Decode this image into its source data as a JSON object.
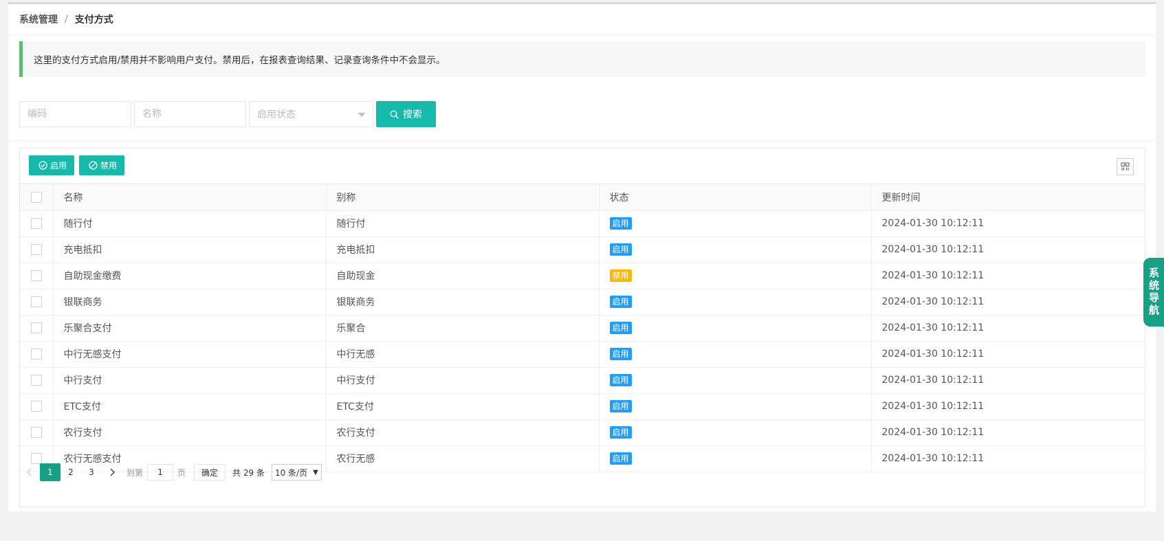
{
  "breadcrumb": {
    "parent": "系统管理",
    "separator": "/",
    "current": "支付方式"
  },
  "notice": "这里的支付方式启用/禁用并不影响用户支付。禁用后，在报表查询结果、记录查询条件中不会显示。",
  "search": {
    "code_placeholder": "编码",
    "name_placeholder": "名称",
    "status_placeholder": "启用状态",
    "button_label": "搜索"
  },
  "toolbar": {
    "enable_label": "启用",
    "disable_label": "禁用"
  },
  "table": {
    "headers": {
      "name": "名称",
      "alias": "别称",
      "status": "状态",
      "updated": "更新时间"
    },
    "rows": [
      {
        "name": "随行付",
        "alias": "随行付",
        "status": "启用",
        "updated": "2024-01-30 10:12:11"
      },
      {
        "name": "充电抵扣",
        "alias": "充电抵扣",
        "status": "启用",
        "updated": "2024-01-30 10:12:11"
      },
      {
        "name": "自助现金缴费",
        "alias": "自助现金",
        "status": "禁用",
        "updated": "2024-01-30 10:12:11"
      },
      {
        "name": "银联商务",
        "alias": "银联商务",
        "status": "启用",
        "updated": "2024-01-30 10:12:11"
      },
      {
        "name": "乐聚合支付",
        "alias": "乐聚合",
        "status": "启用",
        "updated": "2024-01-30 10:12:11"
      },
      {
        "name": "中行无感支付",
        "alias": "中行无感",
        "status": "启用",
        "updated": "2024-01-30 10:12:11"
      },
      {
        "name": "中行支付",
        "alias": "中行支付",
        "status": "启用",
        "updated": "2024-01-30 10:12:11"
      },
      {
        "name": "ETC支付",
        "alias": "ETC支付",
        "status": "启用",
        "updated": "2024-01-30 10:12:11"
      },
      {
        "name": "农行支付",
        "alias": "农行支付",
        "status": "启用",
        "updated": "2024-01-30 10:12:11"
      },
      {
        "name": "农行无感支付",
        "alias": "农行无感",
        "status": "启用",
        "updated": "2024-01-30 10:12:11"
      }
    ]
  },
  "pagination": {
    "pages": [
      "1",
      "2",
      "3"
    ],
    "current": "1",
    "goto_label": "到第",
    "goto_value": "1",
    "page_suffix": "页",
    "confirm_label": "确定",
    "total": "共 29 条",
    "page_size": "10 条/页"
  },
  "sidenav": "系统导航",
  "colors": {
    "primary": "#16baaa",
    "badge_on": "#1e9fff",
    "badge_off": "#ffb800",
    "notice_border": "#5fb878"
  }
}
